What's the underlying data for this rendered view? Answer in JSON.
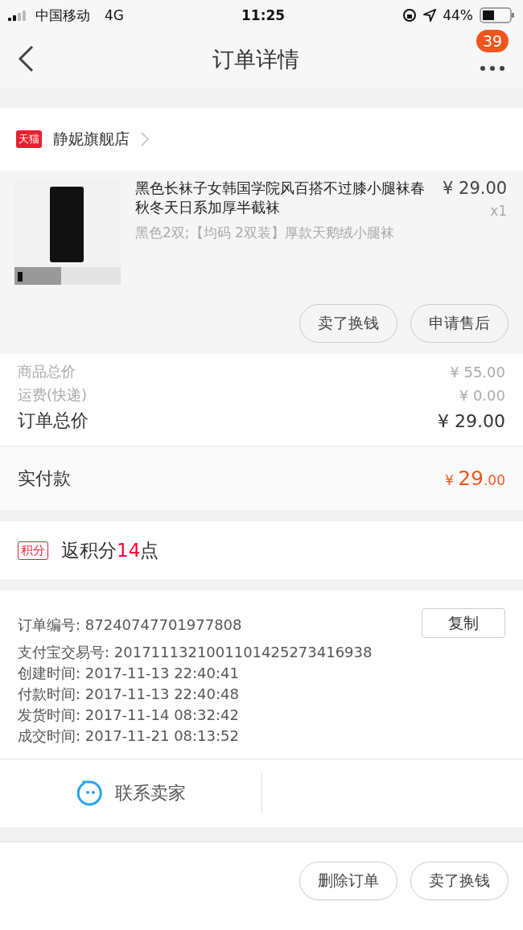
{
  "status_bar": {
    "carrier": "中国移动",
    "network": "4G",
    "time": "11:25",
    "battery": "44%"
  },
  "nav": {
    "title": "订单详情",
    "badge": "39"
  },
  "shop": {
    "badge": "天猫",
    "name": "静妮旗舰店"
  },
  "product": {
    "image": {
      "kind": "picture"
    },
    "title": "黑色长袜子女韩国学院风百搭不过膝小腿袜春秋冬天日系加厚半截袜",
    "price": "¥ 29.00",
    "quantity": "x1",
    "spec": "黑色2双;【均码 2双装】厚款天鹅绒小腿袜",
    "buttons": [
      "卖了换钱",
      "申请售后"
    ]
  },
  "totals": [
    {
      "label": "商品总价",
      "value": "¥ 55.00",
      "kind": "minor"
    },
    {
      "label": "运费(快递)",
      "value": "¥ 0.00",
      "kind": "minor"
    },
    {
      "label": "订单总价",
      "value": "¥ 29.00",
      "kind": "major"
    }
  ],
  "paid": {
    "label": "实付款",
    "currency": "¥",
    "integer": "29",
    "decimal": ".00"
  },
  "points": {
    "badge": "积分",
    "prefix": "返积分",
    "count": "14",
    "suffix": "点"
  },
  "info": {
    "copy_button": "复制",
    "rows": [
      {
        "label": "订单编号:",
        "value": "87240747701977808"
      },
      {
        "label": "支付宝交易号:",
        "value": "2017111321001101425273416938"
      },
      {
        "label": "创建时间:",
        "value": "2017-11-13 22:40:41"
      },
      {
        "label": "付款时间:",
        "value": "2017-11-13 22:40:48"
      },
      {
        "label": "发货时间:",
        "value": "2017-11-14 08:32:42"
      },
      {
        "label": "成交时间:",
        "value": "2017-11-21 08:13:52"
      }
    ]
  },
  "contact": {
    "label": "联系卖家"
  },
  "bottom_buttons": [
    "删除订单",
    "卖了换钱"
  ]
}
